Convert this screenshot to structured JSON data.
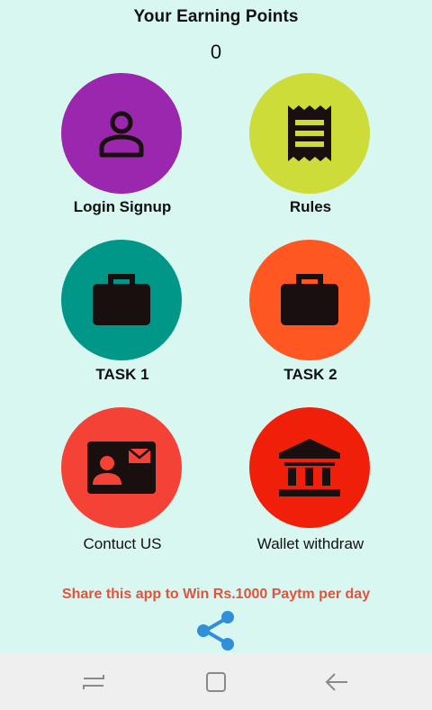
{
  "header": {
    "title": "Your Earning Points",
    "points": "0"
  },
  "tiles": [
    {
      "label": "Login Signup",
      "color": "#9b27af",
      "icon": "person-icon"
    },
    {
      "label": "Rules",
      "color": "#cddc39",
      "icon": "receipt-icon"
    },
    {
      "label": "TASK 1",
      "color": "#009688",
      "icon": "briefcase-icon"
    },
    {
      "label": "TASK 2",
      "color": "#ff5722",
      "icon": "briefcase-icon"
    },
    {
      "label": "Contuct US",
      "color": "#f44336",
      "icon": "contact-card-icon"
    },
    {
      "label": "Wallet withdraw",
      "color": "#f01f0a",
      "icon": "bank-icon"
    }
  ],
  "share": {
    "text": "Share this app to Win Rs.1000 Paytm per day",
    "icon": "share-icon",
    "color": "#e0543f",
    "icon_color": "#2f8fd9"
  },
  "navbar": {
    "buttons": [
      "recent-apps-icon",
      "home-icon",
      "back-icon"
    ]
  },
  "colors": {
    "background": "#d8f7f1",
    "icon_dark": "#1a0f0f"
  }
}
